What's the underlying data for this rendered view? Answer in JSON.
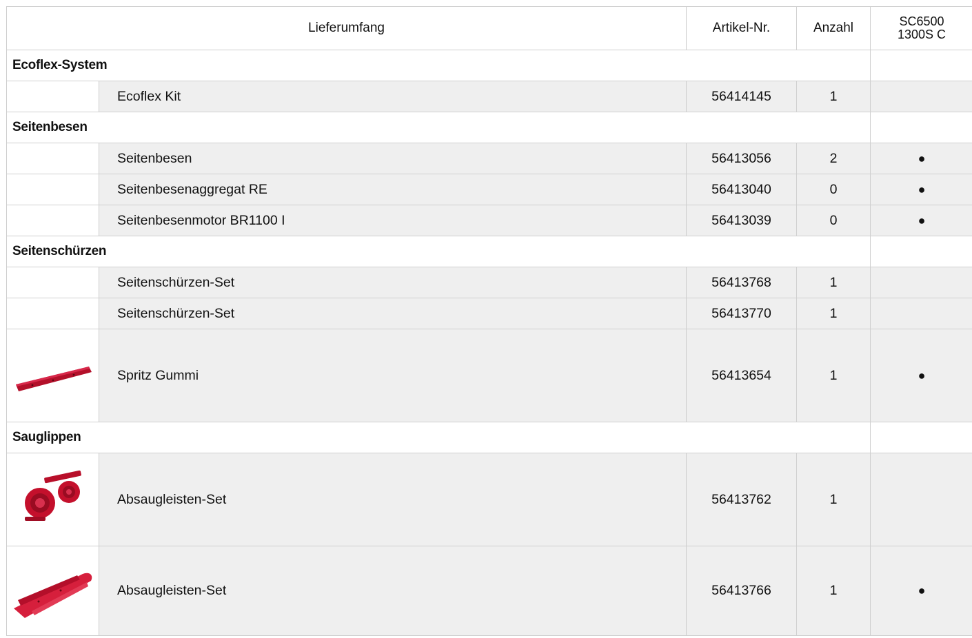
{
  "header": {
    "description": "Lieferumfang",
    "article": "Artikel-Nr.",
    "quantity": "Anzahl",
    "model_line1": "SC6500",
    "model_line2": "1300S C"
  },
  "categories": [
    {
      "name": "Ecoflex-System",
      "items": [
        {
          "name": "Ecoflex Kit",
          "article": "56414145",
          "qty": "1",
          "mark": ""
        }
      ]
    },
    {
      "name": "Seitenbesen",
      "items": [
        {
          "name": "Seitenbesen",
          "article": "56413056",
          "qty": "2",
          "mark": "●"
        },
        {
          "name": "Seitenbesenaggregat RE",
          "article": "56413040",
          "qty": "0",
          "mark": "●"
        },
        {
          "name": "Seitenbesenmotor BR1100 I",
          "article": "56413039",
          "qty": "0",
          "mark": "●"
        }
      ]
    },
    {
      "name": "Seitenschürzen",
      "items": [
        {
          "name": "Seitenschürzen-Set",
          "article": "56413768",
          "qty": "1",
          "mark": ""
        },
        {
          "name": "Seitenschürzen-Set",
          "article": "56413770",
          "qty": "1",
          "mark": ""
        },
        {
          "name": "Spritz Gummi",
          "article": "56413654",
          "qty": "1",
          "mark": "●",
          "image": "red-rubber-strip"
        }
      ]
    },
    {
      "name": "Sauglippen",
      "items": [
        {
          "name": "Absaugleisten-Set",
          "article": "56413762",
          "qty": "1",
          "mark": "",
          "image": "red-rubber-rolls"
        },
        {
          "name": "Absaugleisten-Set",
          "article": "56413766",
          "qty": "1",
          "mark": "●",
          "image": "red-squeegee-blades"
        }
      ]
    }
  ],
  "colors": {
    "row_background": "#efefef",
    "rubber_red": "#c4102c",
    "border": "#cfcfcf"
  }
}
